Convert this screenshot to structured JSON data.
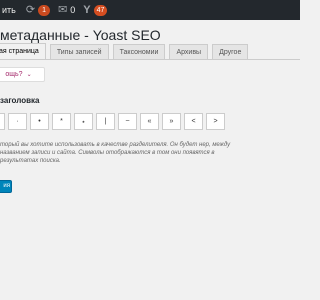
{
  "admin_bar": {
    "partial_label": "ить",
    "updates_count": "1",
    "comments_count": "0",
    "yoast_count": "47"
  },
  "page_title": "метаданные - Yoast SEO",
  "tabs": [
    {
      "label": "ая страница",
      "active": true
    },
    {
      "label": "Типы записей",
      "active": false
    },
    {
      "label": "Таксономии",
      "active": false
    },
    {
      "label": "Архивы",
      "active": false
    },
    {
      "label": "Другое",
      "active": false
    }
  ],
  "help_button": {
    "label": "ощь?"
  },
  "section": {
    "title": "заголовка"
  },
  "separators": [
    "",
    "·",
    "•",
    "*",
    "⋆",
    "|",
    "~",
    "«",
    "»",
    "<",
    ">"
  ],
  "description": "торый вы хотите использовать в качестве разделителя. Он будет нер, между названием записи и сайта. Символы отображаются в том они появятся в результатах поиска.",
  "save_button": {
    "label": "ия"
  },
  "colors": {
    "admin_bar": "#23282d",
    "accent": "#0085ba",
    "yoast": "#a4286a",
    "bubble": "#ca4a1f"
  }
}
